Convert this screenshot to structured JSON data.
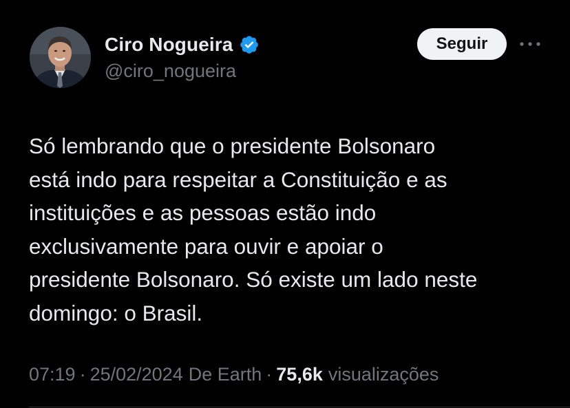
{
  "user": {
    "display_name": "Ciro Nogueira",
    "handle": "@ciro_nogueira",
    "verified": true
  },
  "actions": {
    "follow_label": "Seguir",
    "more_icon": "more-horizontal-icon"
  },
  "tweet": {
    "text": "Só lembrando que o presidente Bolsonaro\nestá indo para respeitar a Constituição e as\ninstituições e as pessoas estão indo\nexclusivamente para ouvir e apoiar o\npresidente Bolsonaro. Só existe um lado neste\ndomingo: o Brasil."
  },
  "meta": {
    "time": "07:19",
    "separator": "·",
    "date": "25/02/2024",
    "source": "De Earth",
    "views_count": "75,6k",
    "views_label": "visualizações"
  },
  "colors": {
    "background": "#000000",
    "text_primary": "#e7e9ea",
    "text_secondary": "#71767b",
    "verified_blue": "#1d9bf0",
    "button_bg": "#eff3f4"
  }
}
